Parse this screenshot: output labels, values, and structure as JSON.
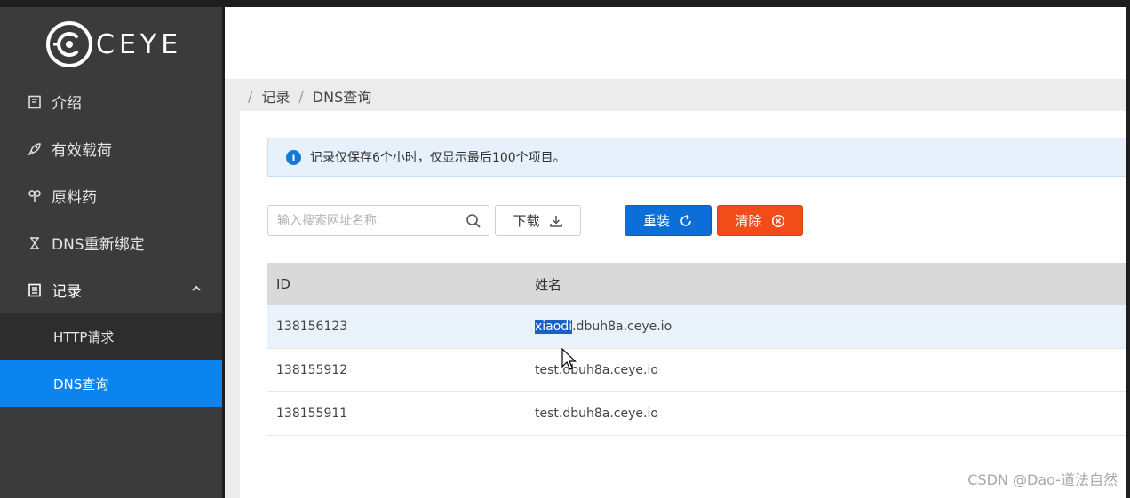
{
  "brand": {
    "name": "CEYE",
    "logo_icon": "ceye-logo-icon"
  },
  "sidebar": {
    "items": [
      {
        "label": "介绍",
        "icon": "book-icon"
      },
      {
        "label": "有效载荷",
        "icon": "rocket-icon"
      },
      {
        "label": "原料药",
        "icon": "api-icon"
      },
      {
        "label": "DNS重新绑定",
        "icon": "hourglass-icon"
      },
      {
        "label": "记录",
        "icon": "list-icon",
        "expanded": true
      }
    ],
    "sub_items": [
      {
        "label": "HTTP请求",
        "active": false
      },
      {
        "label": "DNS查询",
        "active": true
      }
    ]
  },
  "breadcrumb": {
    "items": [
      "记录",
      "DNS查询"
    ]
  },
  "alert": {
    "text": "记录仅保存6个小时，仅显示最后100个项目。",
    "icon": "info-icon"
  },
  "toolbar": {
    "search_placeholder": "输入搜索网址名称",
    "download_label": "下载",
    "reset_label": "重装",
    "clear_label": "清除"
  },
  "table": {
    "headers": [
      "ID",
      "姓名"
    ],
    "rows": [
      {
        "id": "138156123",
        "name_selected": "xiaodi",
        "name_rest": ".dbuh8a.ceye.io"
      },
      {
        "id": "138155912",
        "name": "test.dbuh8a.ceye.io"
      },
      {
        "id": "138155911",
        "name": "test.dbuh8a.ceye.io"
      }
    ]
  },
  "watermark": "CSDN @Dao-道法自然",
  "colors": {
    "sidebar_bg": "#3b3b3b",
    "active_item": "#0c84f0",
    "reset_button": "#0c6fd8",
    "clear_button": "#f04d1a",
    "alert_bg": "#e6f1fc"
  }
}
